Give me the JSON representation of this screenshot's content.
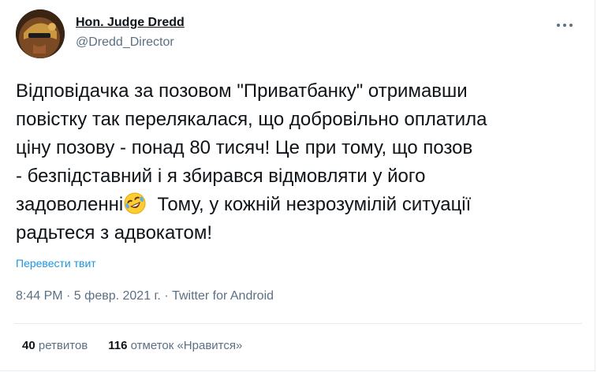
{
  "author": {
    "name": "Hon. Judge Dredd",
    "handle": "@Dredd_Director"
  },
  "tweet": {
    "lines": [
      "Відповідачка за позовом \"Приватбанку\" отримавши",
      "повістку так перелякалася, що добровільно оплатила",
      "ціну позову - понад 80 тисяч! Це при тому, що позов",
      "- безпідставний і я збирався відмовляти у його",
      "задоволенні",
      "  Тому, у кожній незрозумілій ситуації",
      "радьтеся з адвокатом!"
    ],
    "emoji": "rolling-on-floor-laughing-emoji"
  },
  "translate_label": "Перевести твит",
  "meta": "8:44 PM · 5 февр. 2021 г. · Twitter for Android",
  "stats": {
    "retweets_count": "40",
    "retweets_label": "ретвитов",
    "likes_count": "116",
    "likes_label": "отметок «Нравится»"
  },
  "colors": {
    "link": "#1b95e0",
    "muted": "#5b7083",
    "text": "#0f1419"
  }
}
